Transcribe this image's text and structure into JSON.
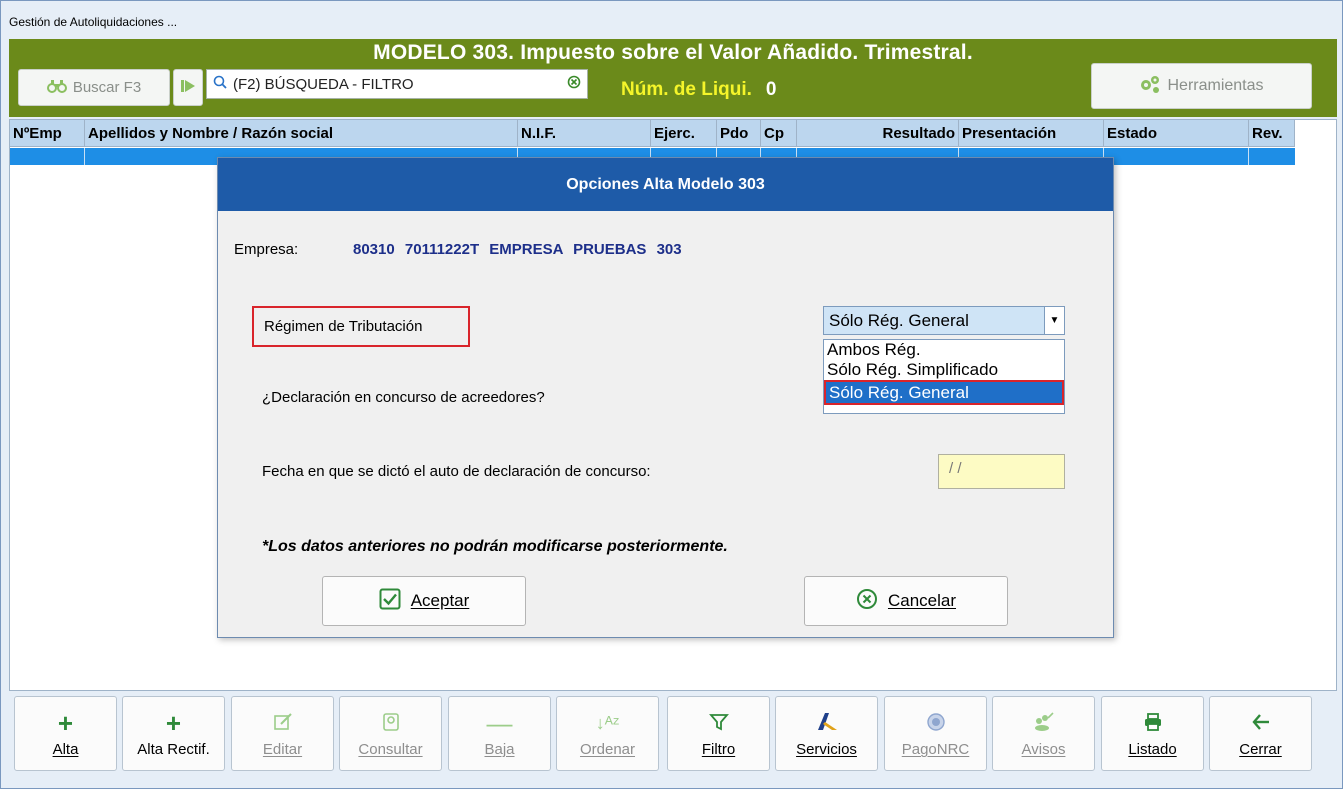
{
  "window": {
    "title": "Gestión de Autoliquidaciones ..."
  },
  "header": {
    "title": "MODELO 303. Impuesto sobre el Valor Añadido. Trimestral.",
    "buscar_label": "Buscar F3",
    "search_value": "(F2) BÚSQUEDA - FILTRO",
    "liqui_label": "Núm. de Liqui.",
    "liqui_value": "0",
    "herramientas_label": "Herramientas"
  },
  "grid": {
    "columns": [
      "NºEmp",
      "Apellidos y Nombre / Razón social",
      "N.I.F.",
      "Ejerc.",
      "Pdo",
      "Cp",
      "Resultado",
      "Presentación",
      "Estado",
      "Rev."
    ]
  },
  "dialog": {
    "title": "Opciones Alta Modelo 303",
    "empresa_label": "Empresa:",
    "empresa_value": "80310  70111222T  EMPRESA PRUEBAS 303",
    "regimen_label": "Régimen de Tributación",
    "regimen_selected": "Sólo Rég. General",
    "regimen_options": [
      "Ambos Rég.",
      "Sólo Rég. Simplificado",
      "Sólo Rég. General"
    ],
    "concurso_label": "¿Declaración en concurso de acreedores?",
    "fecha_label": "Fecha en que se dictó el auto de declaración de concurso:",
    "fecha_value": "/ /",
    "nota": "*Los datos anteriores no podrán modificarse posteriormente.",
    "aceptar_label": "Aceptar",
    "cancelar_label": "Cancelar"
  },
  "toolbar": {
    "alta": "Alta",
    "alta_rectif": "Alta Rectif.",
    "editar": "Editar",
    "consultar": "Consultar",
    "baja": "Baja",
    "ordenar": "Ordenar",
    "filtro": "Filtro",
    "servicios": "Servicios",
    "pago_nrc": "PagoNRC",
    "avisos": "Avisos",
    "listado": "Listado",
    "cerrar": "Cerrar"
  },
  "colors": {
    "header_bg": "#6b8a1a",
    "dialog_title_bg": "#1e5ba8",
    "highlight_red": "#d9242b",
    "row_selected": "#1e8ee6"
  }
}
